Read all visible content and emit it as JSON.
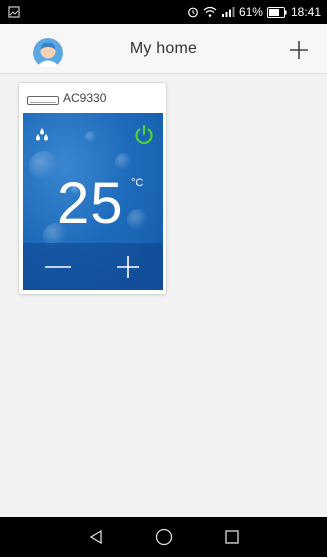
{
  "status_bar": {
    "battery_percent": "61%",
    "time": "18:41",
    "icons": [
      "image-icon",
      "alarm-icon",
      "wifi-icon",
      "signal-icon",
      "battery-icon"
    ]
  },
  "header": {
    "title": "My home",
    "avatar_icon": "user-avatar-icon",
    "add_icon": "plus-icon"
  },
  "device_card": {
    "name": "AC9330",
    "device_icon": "air-conditioner-icon",
    "mode_icon": "water-drops-icon",
    "power_icon": "power-icon",
    "temperature": "25",
    "unit": "°C",
    "decrease_icon": "minus-icon",
    "increase_icon": "plus-icon"
  },
  "nav_bar": {
    "icons": [
      "back-icon",
      "home-icon",
      "recents-icon"
    ]
  },
  "colors": {
    "panel_blue": "#1f6cbc",
    "power_green": "#4cd137",
    "status_bar": "#000000"
  }
}
